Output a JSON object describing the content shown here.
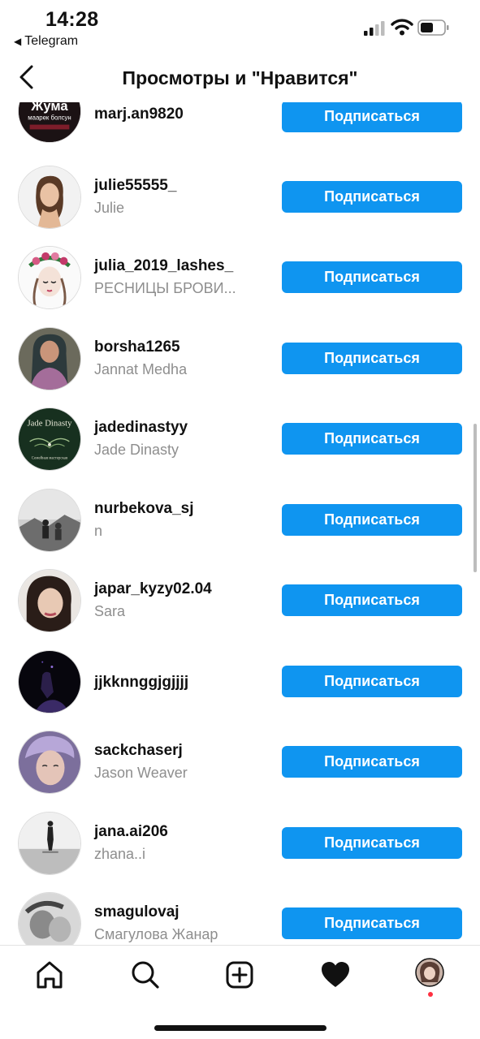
{
  "status_bar": {
    "time": "14:28",
    "back_app": "Telegram",
    "back_arrow": "◀"
  },
  "header": {
    "title": "Просмотры и \"Нравится\"",
    "back_icon": "chevron-left-icon"
  },
  "follow_label": "Подписаться",
  "users": [
    {
      "username": "marj.an9820",
      "fullname": "",
      "avatar_text": "Жума",
      "avatar_subtext": "маарек болсун"
    },
    {
      "username": "julie55555_",
      "fullname": "Julie"
    },
    {
      "username": "julia_2019_lashes_",
      "fullname": "РЕСНИЦЫ БРОВИ..."
    },
    {
      "username": "borsha1265",
      "fullname": "Jannat Medha"
    },
    {
      "username": "jadedinastyy",
      "fullname": "Jade Dinasty",
      "avatar_text": "Jade Dinasty",
      "avatar_subtext": "Семейная мастерская"
    },
    {
      "username": "nurbekova_sj",
      "fullname": "n"
    },
    {
      "username": "japar_kyzy02.04",
      "fullname": "Sara"
    },
    {
      "username": "jjkknnggjgjjjj",
      "fullname": ""
    },
    {
      "username": "sackchaserj",
      "fullname": "Jason Weaver"
    },
    {
      "username": "jana.ai206",
      "fullname": "zhana..i"
    },
    {
      "username": "smagulovaj",
      "fullname": "Смагулова Жанар"
    }
  ],
  "bottom_nav": [
    "home-icon",
    "search-icon",
    "new-post-icon",
    "activity-heart-icon",
    "profile-avatar"
  ],
  "colors": {
    "accent": "#0f95f0",
    "secondary_text": "#8e8e8e",
    "notification_dot": "#ff3040"
  }
}
